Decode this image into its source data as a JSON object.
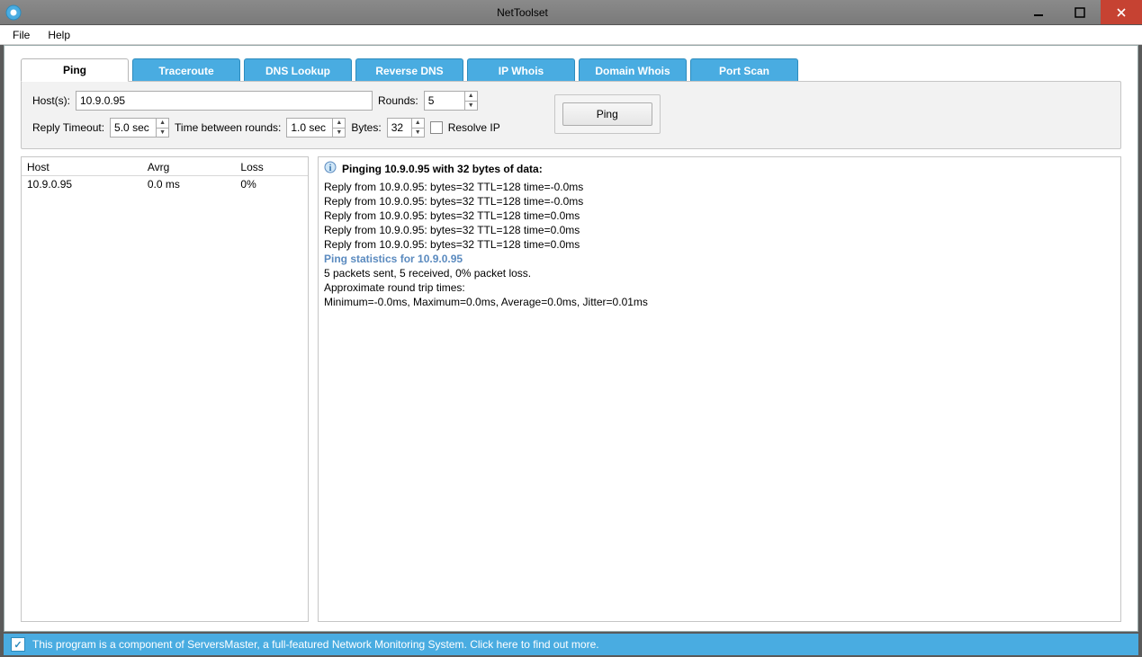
{
  "window": {
    "title": "NetToolset"
  },
  "menu": {
    "file": "File",
    "help": "Help"
  },
  "tabs": [
    {
      "label": "Ping",
      "active": true
    },
    {
      "label": "Traceroute",
      "active": false
    },
    {
      "label": "DNS Lookup",
      "active": false
    },
    {
      "label": "Reverse DNS",
      "active": false
    },
    {
      "label": "IP Whois",
      "active": false
    },
    {
      "label": "Domain Whois",
      "active": false
    },
    {
      "label": "Port Scan",
      "active": false
    }
  ],
  "params": {
    "hosts_label": "Host(s):",
    "hosts_value": "10.9.0.95",
    "rounds_label": "Rounds:",
    "rounds_value": "5",
    "reply_timeout_label": "Reply Timeout:",
    "reply_timeout_value": "5.0 sec",
    "between_label": "Time between rounds:",
    "between_value": "1.0 sec",
    "bytes_label": "Bytes:",
    "bytes_value": "32",
    "resolve_ip_label": "Resolve IP",
    "ping_button": "Ping"
  },
  "summary": {
    "headers": {
      "host": "Host",
      "avrg": "Avrg",
      "loss": "Loss"
    },
    "rows": [
      {
        "host": "10.9.0.95",
        "avrg": "0.0 ms",
        "loss": "0%"
      }
    ]
  },
  "output": {
    "header": "Pinging 10.9.0.95 with 32 bytes of data:",
    "lines": [
      "Reply from 10.9.0.95: bytes=32 TTL=128 time=-0.0ms",
      "Reply from 10.9.0.95: bytes=32 TTL=128 time=-0.0ms",
      "Reply from 10.9.0.95: bytes=32 TTL=128 time=0.0ms",
      "Reply from 10.9.0.95: bytes=32 TTL=128 time=0.0ms",
      "Reply from 10.9.0.95: bytes=32 TTL=128 time=0.0ms"
    ],
    "stats_title": "Ping statistics for 10.9.0.95",
    "stats_lines": [
      "5 packets sent, 5 received, 0% packet loss.",
      "Approximate round trip times:",
      "Minimum=-0.0ms, Maximum=0.0ms, Average=0.0ms, Jitter=0.01ms"
    ]
  },
  "statusbar": {
    "text": "This program is a component of ServersMaster, a full-featured Network Monitoring System. Click here to find out more."
  }
}
